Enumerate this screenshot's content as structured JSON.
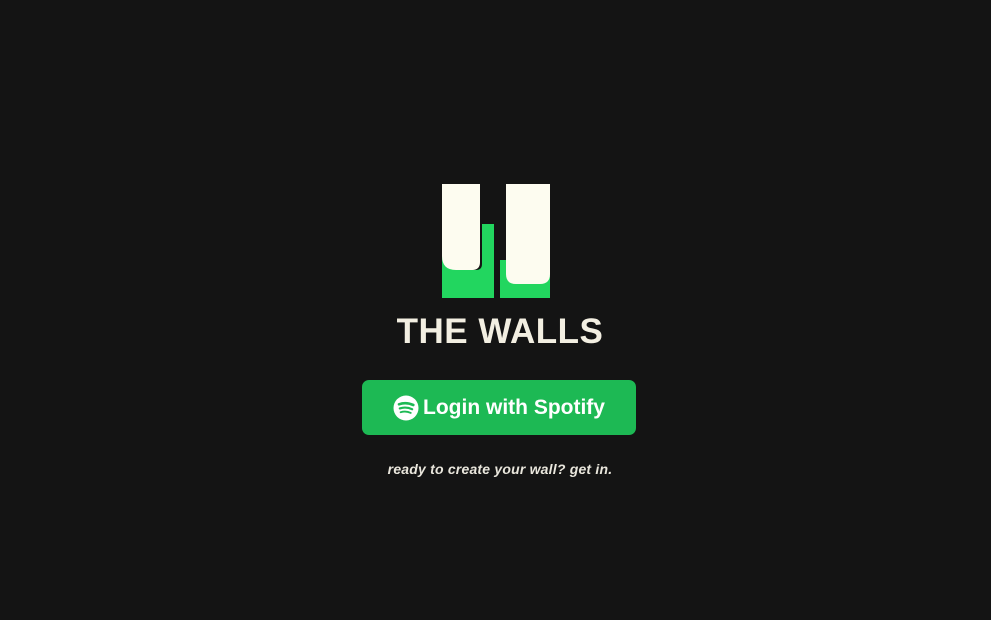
{
  "app": {
    "title": "THE WALLS"
  },
  "logo": {
    "icon": "walls-logo-icon",
    "colors": {
      "panel": "#fdfcf0",
      "accent": "#22d65f"
    }
  },
  "login_button": {
    "label": "Login with Spotify",
    "icon": "spotify-icon",
    "background": "#1db954"
  },
  "tagline": "ready to create your wall? get in.",
  "colors": {
    "background": "#141414",
    "text": "#f3efe2"
  }
}
